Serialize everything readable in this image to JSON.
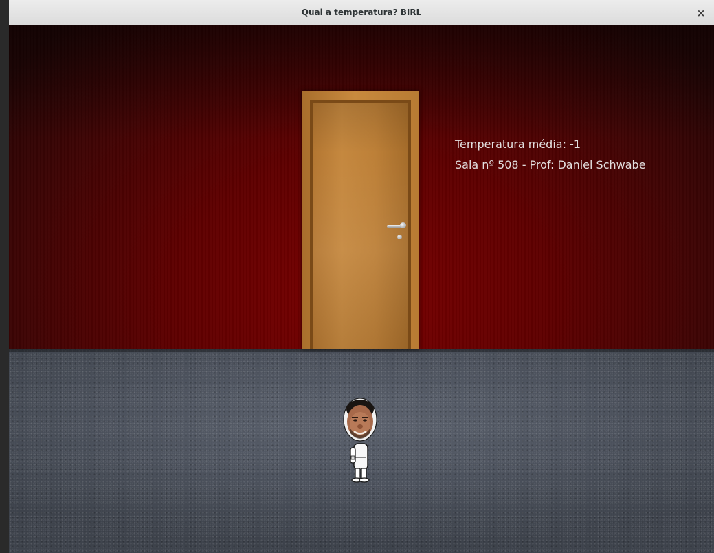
{
  "window": {
    "title": "Qual a temperatura? BIRL",
    "close_label": "×"
  },
  "hud": {
    "temperature_label": "Temperatura média:",
    "temperature_value": "-1",
    "room_line": "Sala nº 508 - Prof: Daniel Schwabe"
  },
  "scene": {
    "wall_color": "#6b0000",
    "floor_color": "#4f5560",
    "door_color": "#c08440"
  },
  "icons": {
    "close": "close-icon",
    "door_handle": "door-handle-icon",
    "player": "player-character-icon"
  }
}
